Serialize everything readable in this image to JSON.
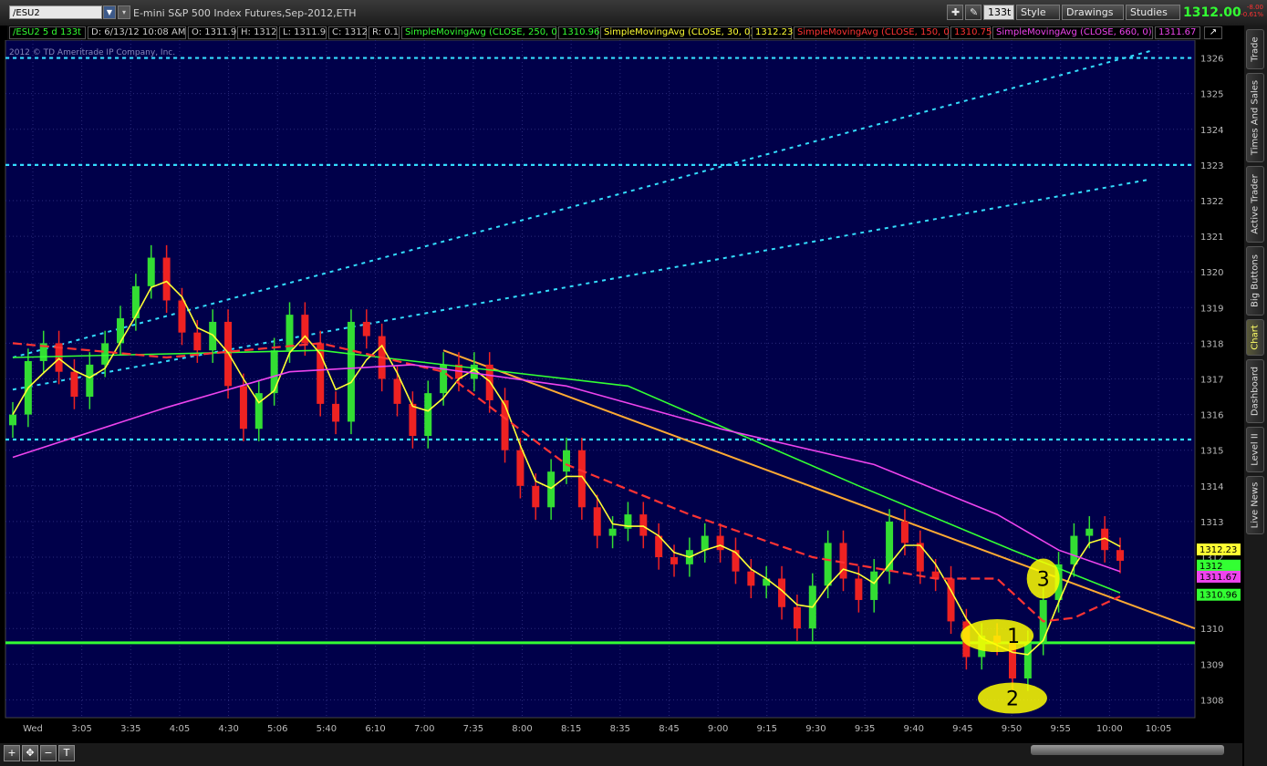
{
  "toolbar": {
    "symbol": "/ESU2",
    "description": "E-mini S&P 500 Index Futures,Sep-2012,ETH",
    "tick_label": "133t",
    "style_label": "Style",
    "drawings_label": "Drawings",
    "studies_label": "Studies",
    "last_price": "1312.00",
    "change": "-8.00",
    "change_pct": "-0.61%"
  },
  "infobar": {
    "symbol": "/ESU2 5 d 133t",
    "date": "D: 6/13/12 10:08 AM",
    "open": "O: 1311.9",
    "high": "H: 1312",
    "low": "L: 1311.9",
    "close": "C: 1312",
    "range": "R: 0.1",
    "studies": [
      {
        "label": "SimpleMovingAvg (CLOSE, 250, 0)",
        "value": "1310.96",
        "color": "#33ff33"
      },
      {
        "label": "SimpleMovingAvg (CLOSE, 30, 0)",
        "value": "1312.23",
        "color": "#ffff33"
      },
      {
        "label": "SimpleMovingAvg (CLOSE, 150, 0)",
        "value": "1310.75",
        "color": "#ff3333"
      },
      {
        "label": "SimpleMovingAvg (CLOSE, 660, 0)",
        "value": "1311.67",
        "color": "#ee44ee"
      }
    ]
  },
  "copyright": "2012 © TD Ameritrade IP Company, Inc.",
  "annotations": [
    "1",
    "2",
    "3"
  ],
  "price_tags": [
    {
      "label": "1312.23",
      "value": 1312.23,
      "color": "#ffff33"
    },
    {
      "label": "1312",
      "value": 1311.93,
      "color": "#33ff33"
    },
    {
      "label": "1311.67",
      "value": 1311.67,
      "color": "#ee44ee"
    },
    {
      "label": "1310.96",
      "value": 1310.96,
      "color": "#33ff33"
    }
  ],
  "side_tabs": [
    "Trade",
    "Times And Sales",
    "Active Trader",
    "Big Buttons",
    "Chart",
    "Dashboard",
    "Level II",
    "Live News"
  ],
  "active_tab": "Chart",
  "colors": {
    "background": "#00004a",
    "grid": "#2a2a7a",
    "up": "#33dd33",
    "down": "#ee2222",
    "trend": "#ffaa33",
    "support": "#33ff33",
    "fib": "#33ddff"
  },
  "chart_data": {
    "type": "candlestick",
    "ylim": [
      1307.5,
      1326.5
    ],
    "y_ticks": [
      1308,
      1309,
      1310,
      1311,
      1312,
      1313,
      1314,
      1315,
      1316,
      1317,
      1318,
      1319,
      1320,
      1321,
      1322,
      1323,
      1324,
      1325,
      1326
    ],
    "x_tick_labels": [
      "Wed",
      "3:05",
      "3:35",
      "4:05",
      "4:30",
      "5:06",
      "5:40",
      "6:10",
      "7:00",
      "7:35",
      "8:00",
      "8:15",
      "8:35",
      "8:45",
      "9:00",
      "9:15",
      "9:30",
      "9:35",
      "9:40",
      "9:45",
      "9:50",
      "9:55",
      "10:00",
      "10:05"
    ],
    "close": [
      1316.0,
      1317.5,
      1318.0,
      1317.2,
      1316.5,
      1317.4,
      1318.0,
      1318.7,
      1319.6,
      1320.4,
      1319.2,
      1318.3,
      1317.8,
      1318.6,
      1316.8,
      1315.6,
      1316.6,
      1317.8,
      1318.8,
      1318.0,
      1316.3,
      1315.8,
      1318.6,
      1318.2,
      1317.0,
      1316.3,
      1315.4,
      1316.6,
      1317.4,
      1317.0,
      1317.4,
      1316.4,
      1315.0,
      1314.0,
      1313.4,
      1314.4,
      1315.0,
      1313.4,
      1312.6,
      1312.8,
      1313.2,
      1312.6,
      1312.0,
      1311.8,
      1312.2,
      1312.6,
      1312.2,
      1311.6,
      1311.2,
      1311.4,
      1310.6,
      1310.0,
      1311.2,
      1312.4,
      1311.4,
      1310.8,
      1311.6,
      1313.0,
      1312.4,
      1311.6,
      1311.4,
      1310.2,
      1309.2,
      1309.8,
      1309.6,
      1308.6,
      1309.6,
      1310.8,
      1311.8,
      1312.6,
      1312.8,
      1312.2,
      1311.9
    ],
    "moving_averages": [
      {
        "name": "SimpleMovingAvg (CLOSE, 250, 0)",
        "color": "#33ff33",
        "points": [
          [
            0,
            1317.6
          ],
          [
            20,
            1317.8
          ],
          [
            40,
            1316.8
          ],
          [
            55,
            1314.0
          ],
          [
            65,
            1312.2
          ],
          [
            72,
            1311.0
          ]
        ]
      },
      {
        "name": "SimpleMovingAvg (CLOSE, 30, 0)",
        "color": "#ffff33",
        "points": []
      },
      {
        "name": "SimpleMovingAvg (CLOSE, 150, 0)",
        "color": "#ff3333",
        "points": [
          [
            0,
            1318.0
          ],
          [
            10,
            1317.6
          ],
          [
            20,
            1318.0
          ],
          [
            28,
            1317.2
          ],
          [
            36,
            1314.6
          ],
          [
            44,
            1313.2
          ],
          [
            52,
            1312.0
          ],
          [
            60,
            1311.4
          ],
          [
            64,
            1311.4
          ],
          [
            67,
            1310.2
          ],
          [
            69,
            1310.3
          ],
          [
            72,
            1310.9
          ]
        ]
      },
      {
        "name": "SimpleMovingAvg (CLOSE, 660, 0)",
        "color": "#ee44ee",
        "points": [
          [
            0,
            1314.8
          ],
          [
            10,
            1316.2
          ],
          [
            18,
            1317.2
          ],
          [
            26,
            1317.4
          ],
          [
            36,
            1316.8
          ],
          [
            46,
            1315.6
          ],
          [
            56,
            1314.6
          ],
          [
            64,
            1313.2
          ],
          [
            68,
            1312.2
          ],
          [
            72,
            1311.6
          ]
        ]
      }
    ],
    "horizontal_lines": [
      1326.0,
      1323.0,
      1315.3
    ],
    "support_line": 1309.6,
    "trend_lines": [
      {
        "from": [
          28,
          1317.8
        ],
        "to": [
          74,
          1310.0
        ]
      }
    ],
    "rising_lines": [
      {
        "from": [
          0,
          1317.6
        ],
        "to": [
          74,
          1326.2
        ]
      },
      {
        "from": [
          0,
          1316.7
        ],
        "to": [
          74,
          1322.6
        ]
      }
    ]
  }
}
